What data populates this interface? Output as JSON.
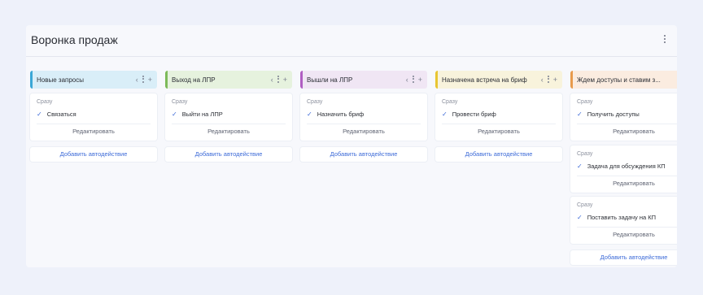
{
  "page": {
    "title": "Воронка продаж"
  },
  "common": {
    "when": "Сразу",
    "edit": "Редактировать",
    "add_auto": "Добавить автодействие"
  },
  "columns": [
    {
      "title": "Новые запросы",
      "color": "#d9eef8",
      "accent": "#3aa7d6",
      "tasks": [
        "Связаться"
      ]
    },
    {
      "title": "Выход на ЛПР",
      "color": "#e6f2de",
      "accent": "#7dba5a",
      "tasks": [
        "Выйти на ЛПР"
      ]
    },
    {
      "title": "Вышли на ЛПР",
      "color": "#f0e6f4",
      "accent": "#b05dc2",
      "tasks": [
        "Назначить бриф"
      ]
    },
    {
      "title": "Назначена встреча на бриф",
      "color": "#f8f3dc",
      "accent": "#e8c531",
      "tasks": [
        "Провести бриф"
      ]
    },
    {
      "title": "Ждем доступы и ставим з...",
      "color": "#fbece0",
      "accent": "#e89a4c",
      "tasks": [
        "Получить доступы",
        "Задача для обсуждения КП",
        "Поставить задачу на КП"
      ]
    }
  ],
  "help_icon": "?"
}
